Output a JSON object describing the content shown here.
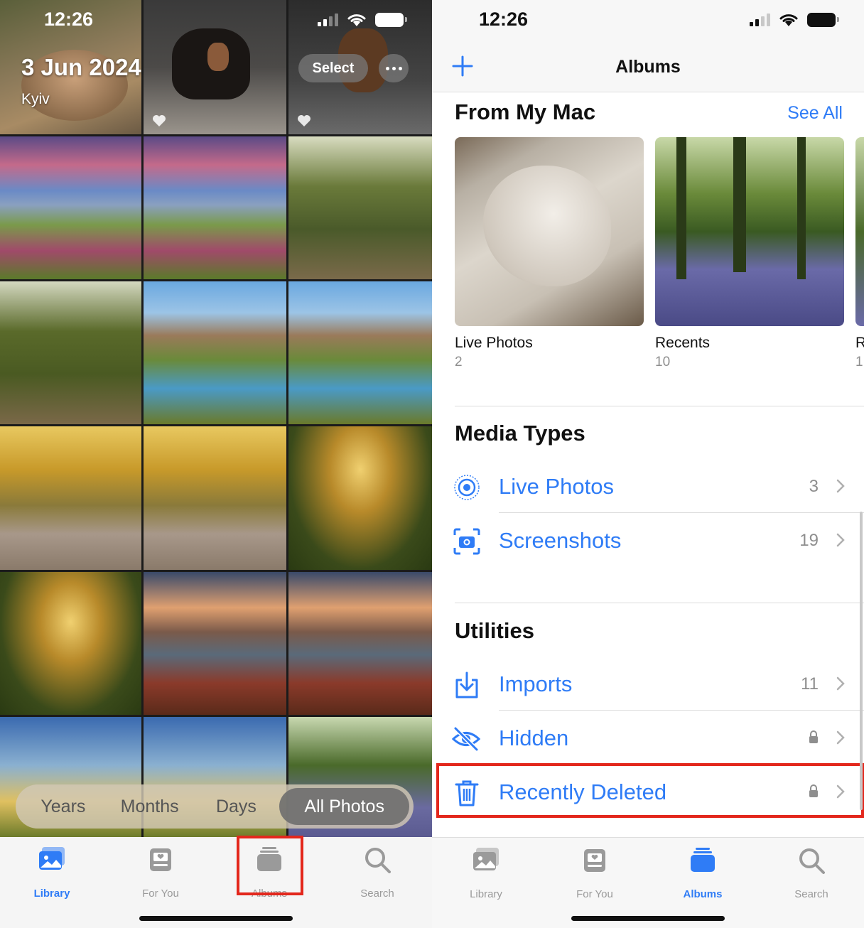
{
  "left_phone": {
    "status_time": "12:26",
    "date_title": "3 Jun 2024",
    "location": "Kyiv",
    "select_label": "Select",
    "more_icon": "ellipsis-icon",
    "view_options": [
      "Years",
      "Months",
      "Days",
      "All Photos"
    ],
    "view_selected": "All Photos",
    "tabs": [
      {
        "label": "Library",
        "icon": "photo-library-icon",
        "active": true
      },
      {
        "label": "For You",
        "icon": "for-you-icon",
        "active": false
      },
      {
        "label": "Albums",
        "icon": "albums-icon",
        "active": false
      },
      {
        "label": "Search",
        "icon": "search-icon",
        "active": false
      }
    ],
    "highlighted_tab": "Albums"
  },
  "right_phone": {
    "status_time": "12:26",
    "nav_title": "Albums",
    "from_my_mac": {
      "title": "From My Mac",
      "see_all": "See All",
      "albums": [
        {
          "name": "Live Photos",
          "count": "2"
        },
        {
          "name": "Recents",
          "count": "10"
        },
        {
          "name": "R",
          "count": "1"
        }
      ]
    },
    "media_types": {
      "title": "Media Types",
      "items": [
        {
          "label": "Live Photos",
          "count": "3",
          "icon": "live-photos-icon"
        },
        {
          "label": "Screenshots",
          "count": "19",
          "icon": "screenshot-icon"
        }
      ]
    },
    "utilities": {
      "title": "Utilities",
      "items": [
        {
          "label": "Imports",
          "count": "11",
          "icon": "import-icon",
          "locked": false
        },
        {
          "label": "Hidden",
          "icon": "eye-slash-icon",
          "locked": true
        },
        {
          "label": "Recently Deleted",
          "icon": "trash-icon",
          "locked": true
        }
      ]
    },
    "highlighted_row": "Recently Deleted",
    "tabs": [
      {
        "label": "Library",
        "icon": "photo-library-icon",
        "active": false
      },
      {
        "label": "For You",
        "icon": "for-you-icon",
        "active": false
      },
      {
        "label": "Albums",
        "icon": "albums-icon",
        "active": true
      },
      {
        "label": "Search",
        "icon": "search-icon",
        "active": false
      }
    ]
  },
  "colors": {
    "accent": "#2f7cf6",
    "highlight": "#e3271c"
  }
}
